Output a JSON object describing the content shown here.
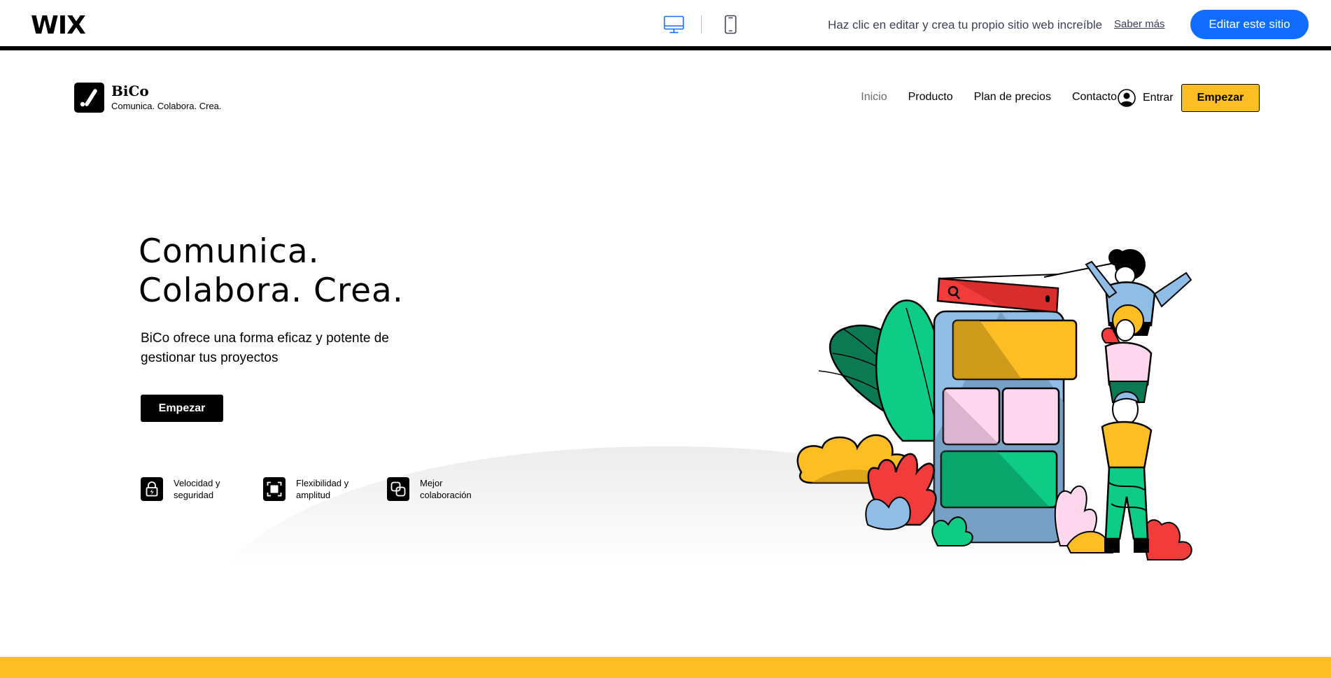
{
  "wix_bar": {
    "logo": "WIX",
    "message": "Haz clic en editar y crea tu propio sitio web increíble",
    "learn_more": "Saber más",
    "edit_button": "Editar este sitio",
    "active_view": "desktop"
  },
  "site": {
    "brand": {
      "name": "BiCo",
      "tagline": "Comunica. Colabora. Crea."
    },
    "nav": [
      {
        "label": "Inicio",
        "active": true
      },
      {
        "label": "Producto",
        "active": false
      },
      {
        "label": "Plan de precios",
        "active": false
      },
      {
        "label": "Contacto",
        "active": false
      }
    ],
    "login_label": "Entrar",
    "cta_label": "Empezar"
  },
  "hero": {
    "title_line1": "Comunica.",
    "title_line2": "Colabora. Crea.",
    "description": "BiCo ofrece una forma eficaz y potente de gestionar tus proyectos",
    "cta_label": "Empezar",
    "features": [
      {
        "icon": "lock-bolt-icon",
        "label": "Velocidad y seguridad"
      },
      {
        "icon": "expand-square-icon",
        "label": "Flexibilidad y amplitud"
      },
      {
        "icon": "overlap-squares-icon",
        "label": "Mejor colaboración"
      }
    ]
  },
  "colors": {
    "wix_blue": "#116dff",
    "accent_yellow": "#fdbe23",
    "black": "#000000",
    "green": "#0ecb86",
    "red": "#f23b3b",
    "pink": "#ffd7ef",
    "light_blue": "#8fbde6"
  }
}
